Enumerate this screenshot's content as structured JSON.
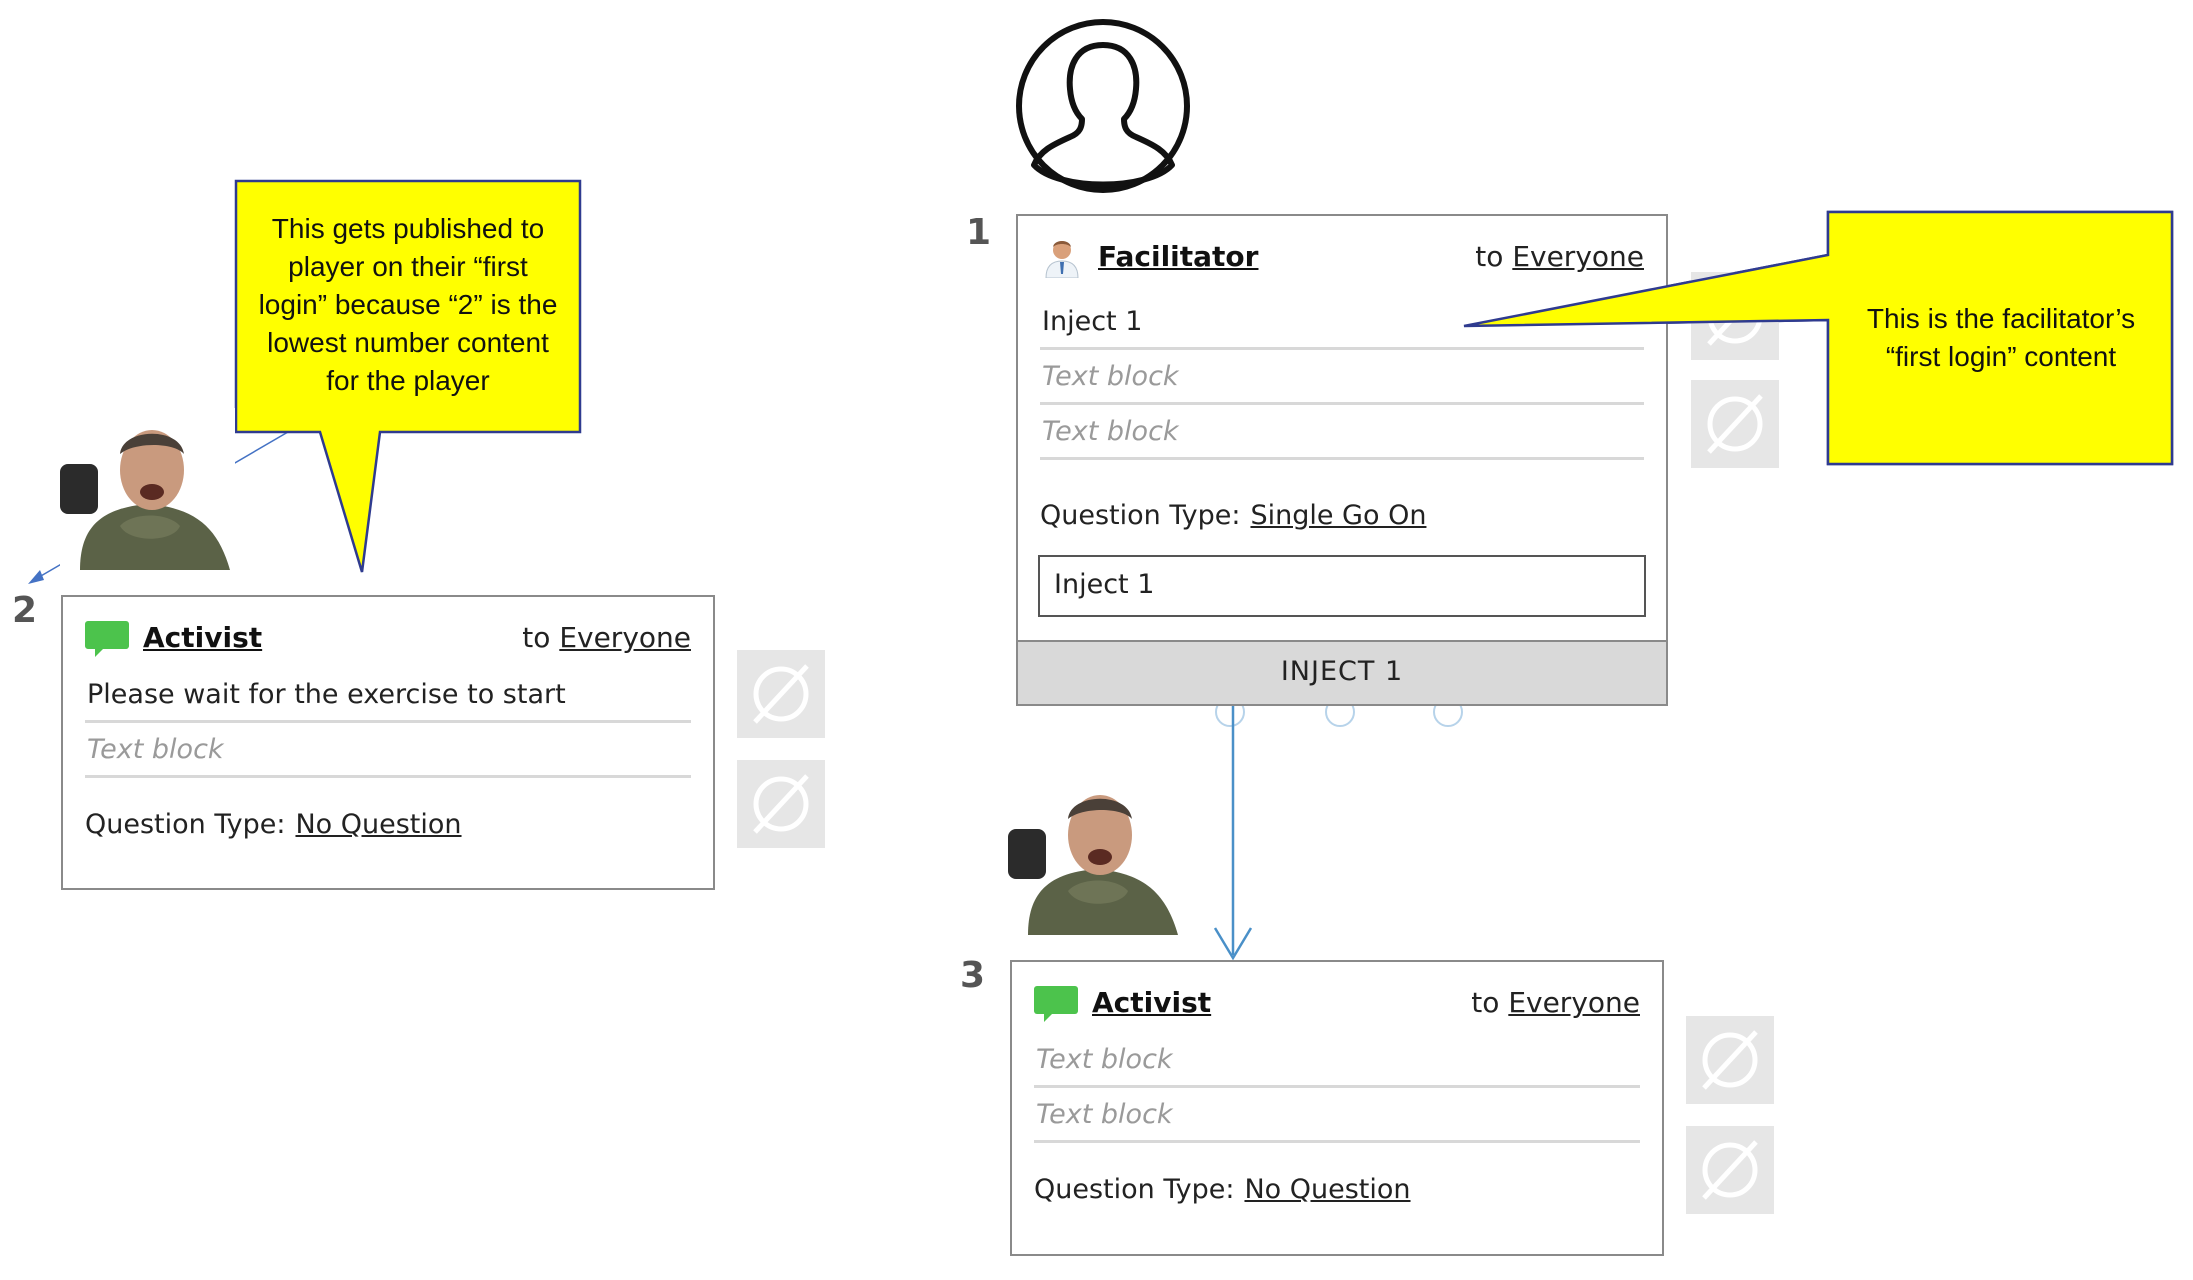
{
  "colors": {
    "callout_fill": "#FFFF00",
    "callout_border": "#2F3B8F",
    "connector": "#4A90C8",
    "chat_icon": "#4CC34C",
    "tile_bg": "#E6E6E6",
    "inject_bar": "#D9D9D9"
  },
  "facilitator_avatar": {
    "icon": "person-outline-icon"
  },
  "callouts": {
    "left": "This gets published to player on their “first login” because “2” is the lowest number content for the player",
    "right": "This is the facilitator’s “first login” content"
  },
  "cards": {
    "c1": {
      "number": "1",
      "role": "Facilitator",
      "role_icon": "facilitator-person-icon",
      "to_label": "to",
      "audience": "Everyone",
      "rows": [
        "Inject 1",
        "Text block",
        "Text block"
      ],
      "question_label": "Question Type:",
      "question_value": "Single Go On",
      "answer_text": "Inject 1",
      "button_label": "INJECT 1"
    },
    "c2": {
      "number": "2",
      "role": "Activist",
      "role_icon": "chat-bubble-icon",
      "to_label": "to",
      "audience": "Everyone",
      "rows": [
        "Please wait for the exercise to start",
        "Text block"
      ],
      "question_label": "Question Type:",
      "question_value": "No Question"
    },
    "c3": {
      "number": "3",
      "role": "Activist",
      "role_icon": "chat-bubble-icon",
      "to_label": "to",
      "audience": "Everyone",
      "rows": [
        "Text block",
        "Text block"
      ],
      "question_label": "Question Type:",
      "question_value": "No Question"
    }
  },
  "tiles": {
    "icon": "empty-set-icon"
  }
}
